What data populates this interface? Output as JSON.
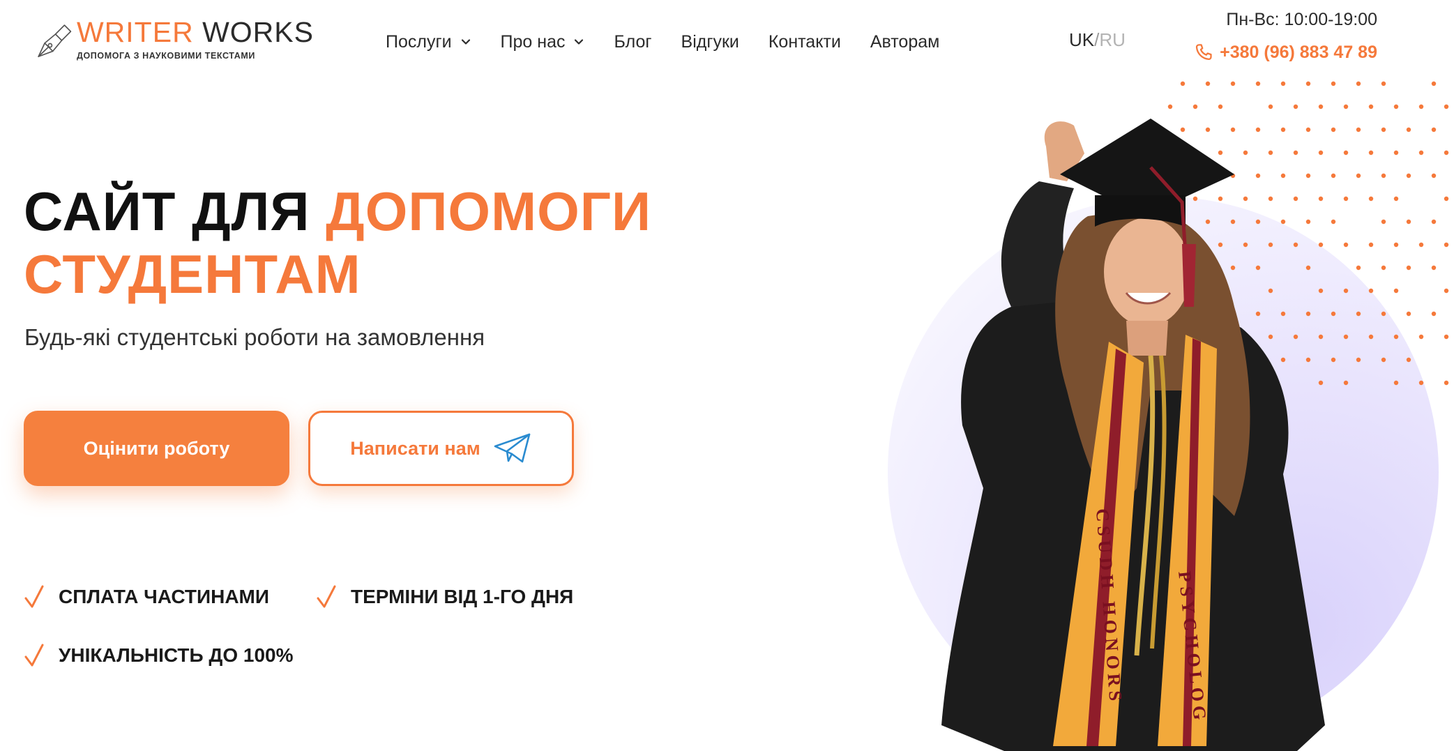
{
  "brand": {
    "name_part1": "WRITER",
    "name_part2": "WORKS",
    "tagline": "ДОПОМОГА З НАУКОВИМИ ТЕКСТАМИ",
    "accent_color": "#f5793b"
  },
  "nav": {
    "items": [
      {
        "label": "Послуги",
        "has_dropdown": true
      },
      {
        "label": "Про нас",
        "has_dropdown": true
      },
      {
        "label": "Блог",
        "has_dropdown": false
      },
      {
        "label": "Відгуки",
        "has_dropdown": false
      },
      {
        "label": "Контакти",
        "has_dropdown": false
      },
      {
        "label": "Авторам",
        "has_dropdown": false
      }
    ]
  },
  "language": {
    "active": "UK",
    "separator": "/",
    "inactive": "RU"
  },
  "contact": {
    "hours": "Пн-Вс: 10:00-19:00",
    "phone": "+380 (96) 883 47 89",
    "phone_icon": "phone-icon"
  },
  "hero": {
    "title_dark": "САЙТ ДЛЯ ",
    "title_accent_line1": "ДОПОМОГИ",
    "title_accent_line2": "СТУДЕНТАМ",
    "subtitle": "Будь-які студентські роботи на замовлення",
    "primary_button": "Оцінити роботу",
    "secondary_button": "Написати нам",
    "secondary_button_icon": "telegram-icon"
  },
  "features": [
    {
      "label": "СПЛАТА ЧАСТИНАМИ",
      "icon": "check-icon"
    },
    {
      "label": "ТЕРМІНИ ВІД 1-ГО ДНЯ",
      "icon": "check-icon"
    },
    {
      "label": "УНІКАЛЬНІСТЬ ДО 100%",
      "icon": "check-icon"
    }
  ],
  "graphic": {
    "stole_left_text": "CSUDH HONORS",
    "stole_right_text": "PSYCHOLOG"
  }
}
